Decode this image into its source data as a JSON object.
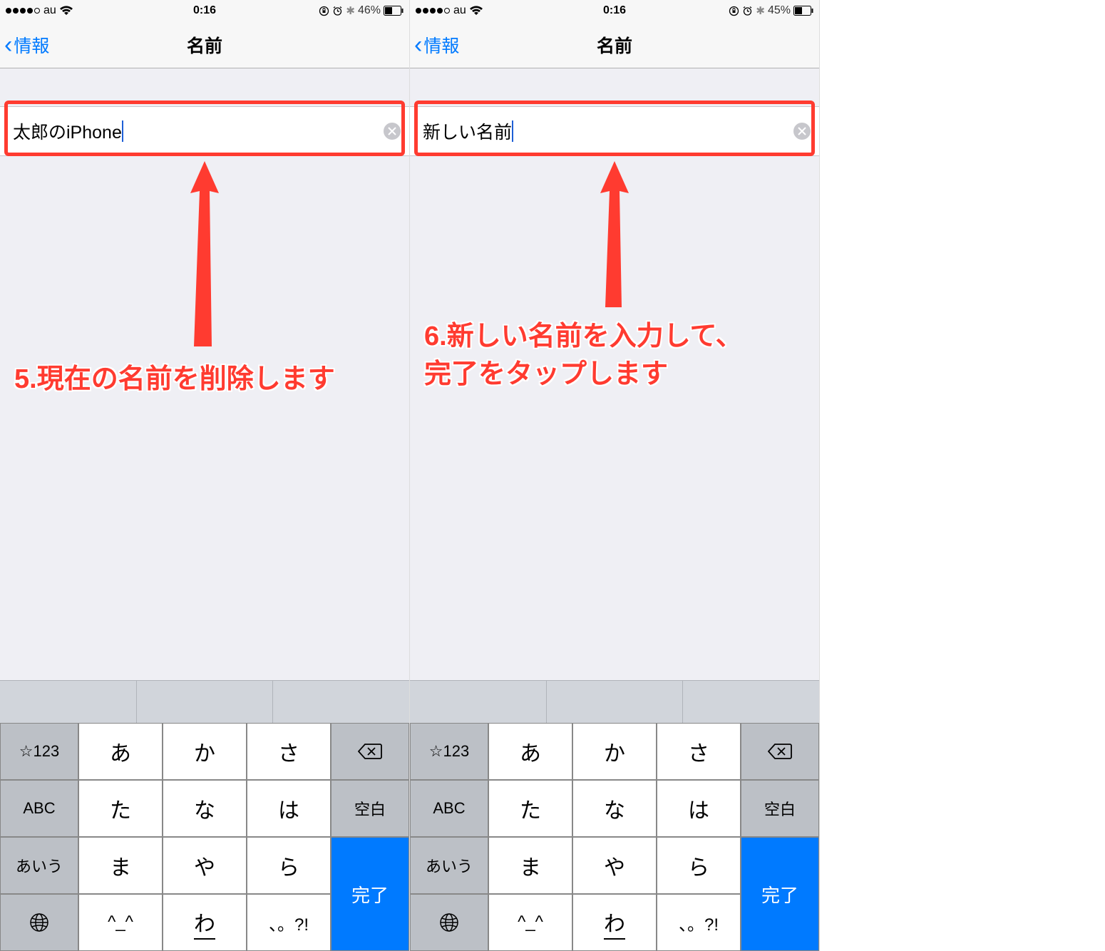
{
  "screens": [
    {
      "status": {
        "carrier": "au",
        "time": "0:16",
        "battery": "46%"
      },
      "nav": {
        "back_label": "情報",
        "title": "名前"
      },
      "field": {
        "value": "太郎のiPhone"
      },
      "annotation": "5.現在の名前を削除します",
      "keyboard": {
        "mode123": "☆123",
        "abc": "ABC",
        "kana": "あいう",
        "rows": [
          [
            "あ",
            "か",
            "さ"
          ],
          [
            "た",
            "な",
            "は"
          ],
          [
            "ま",
            "や",
            "ら"
          ],
          [
            "^_^",
            "わ",
            "、。?!"
          ]
        ],
        "space": "空白",
        "done": "完了"
      }
    },
    {
      "status": {
        "carrier": "au",
        "time": "0:16",
        "battery": "45%"
      },
      "nav": {
        "back_label": "情報",
        "title": "名前"
      },
      "field": {
        "value": "新しい名前"
      },
      "annotation": "6.新しい名前を入力して、\n完了をタップします",
      "keyboard": {
        "mode123": "☆123",
        "abc": "ABC",
        "kana": "あいう",
        "rows": [
          [
            "あ",
            "か",
            "さ"
          ],
          [
            "た",
            "な",
            "は"
          ],
          [
            "ま",
            "や",
            "ら"
          ],
          [
            "^_^",
            "わ",
            "、。?!"
          ]
        ],
        "space": "空白",
        "done": "完了"
      }
    }
  ]
}
